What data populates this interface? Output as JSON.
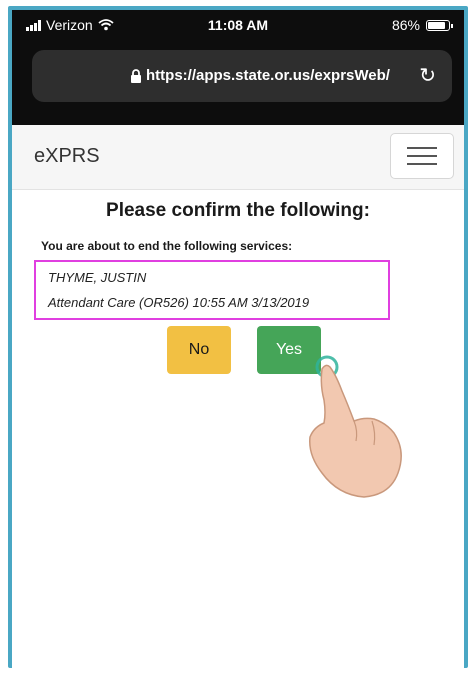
{
  "status_bar": {
    "carrier": "Verizon",
    "time": "11:08 AM",
    "battery": "86%"
  },
  "browser": {
    "url": "https://apps.state.or.us/exprsWeb/"
  },
  "navbar": {
    "brand": "eXPRS"
  },
  "dialog": {
    "title": "Please confirm the following:",
    "subtitle": "You are about to end the following services:",
    "client_name": "THYME, JUSTIN",
    "service_line": "Attendant Care (OR526) 10:55 AM 3/13/2019",
    "no_label": "No",
    "yes_label": "Yes"
  },
  "colors": {
    "frame_border": "#4aa7c4",
    "highlight_box": "#e03fe0",
    "no_button": "#f2c043",
    "yes_button": "#45a558"
  },
  "icons": [
    "signal-icon",
    "wifi-icon",
    "battery-icon",
    "lock-icon",
    "reload-icon",
    "hamburger-icon",
    "pointing-hand-icon"
  ]
}
